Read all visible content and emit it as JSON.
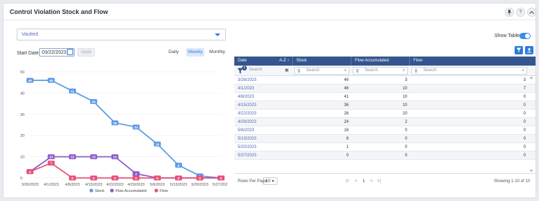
{
  "header": {
    "title": "Control Violation Stock and Flow",
    "pin_icon": "pin-icon",
    "help_icon": "help-icon",
    "help_glyph": "?",
    "collapse_icon": "chevron-up-icon"
  },
  "controls": {
    "dropdown_value": "Vaulted",
    "start_date_label": "Start Date:",
    "start_date_value": "03/22/2023",
    "apply_label": "Apply",
    "periods": [
      "Daily",
      "Weekly",
      "Monthly"
    ],
    "active_period": "Weekly"
  },
  "table_controls": {
    "show_table_label": "Show Table",
    "show_table_on": true,
    "filter_button_icon": "filter-clear-icon",
    "export_button_icon": "export-icon"
  },
  "chart_data": {
    "type": "line",
    "categories": [
      "3/26/2023",
      "4/1/2023",
      "4/8/2023",
      "4/15/2023",
      "4/22/2023",
      "4/29/2023",
      "5/6/2023",
      "5/13/2023",
      "5/20/2023",
      "5/27/2023"
    ],
    "y_ticks": [
      "0",
      "10",
      "20",
      "30",
      "40",
      "50"
    ],
    "ylim": [
      0,
      50
    ],
    "series": [
      {
        "name": "Stock",
        "color": "#5b9be6",
        "values": [
          46,
          46,
          41,
          36,
          26,
          24,
          16,
          6,
          1,
          0
        ]
      },
      {
        "name": "Flow Accumulated",
        "color": "#8a5cc8",
        "values": [
          3,
          10,
          10,
          10,
          10,
          2,
          0,
          0,
          0,
          0
        ]
      },
      {
        "name": "Flow",
        "color": "#e8527a",
        "values": [
          3,
          7,
          0,
          0,
          0,
          0,
          0,
          0,
          0,
          0
        ]
      }
    ],
    "legend_position": "bottom",
    "grid": true
  },
  "table": {
    "columns": [
      {
        "label": "Date",
        "sort": "A-Z"
      },
      {
        "label": "Stock",
        "sort": ""
      },
      {
        "label": "Flow Accumulated",
        "sort": ""
      },
      {
        "label": "Flow",
        "sort": ""
      }
    ],
    "filter_badge": "1",
    "filter_placeholder": "Search",
    "rows": [
      {
        "date": "3/26/2023",
        "stock": "46",
        "flow_acc": "3",
        "flow": "3"
      },
      {
        "date": "4/1/2023",
        "stock": "46",
        "flow_acc": "10",
        "flow": "7"
      },
      {
        "date": "4/8/2023",
        "stock": "41",
        "flow_acc": "10",
        "flow": "0"
      },
      {
        "date": "4/15/2023",
        "stock": "36",
        "flow_acc": "10",
        "flow": "0"
      },
      {
        "date": "4/22/2023",
        "stock": "26",
        "flow_acc": "10",
        "flow": "0"
      },
      {
        "date": "4/29/2023",
        "stock": "24",
        "flow_acc": "2",
        "flow": "0"
      },
      {
        "date": "5/6/2023",
        "stock": "16",
        "flow_acc": "0",
        "flow": "0"
      },
      {
        "date": "5/13/2023",
        "stock": "6",
        "flow_acc": "0",
        "flow": "0"
      },
      {
        "date": "5/20/2023",
        "stock": "1",
        "flow_acc": "0",
        "flow": "0"
      },
      {
        "date": "5/27/2023",
        "stock": "0",
        "flow_acc": "0",
        "flow": "0"
      }
    ],
    "rows_per_page_label": "Rows Per Page:",
    "rows_per_page": "10",
    "page": "1",
    "showing": "Showing 1-10 of 10"
  }
}
